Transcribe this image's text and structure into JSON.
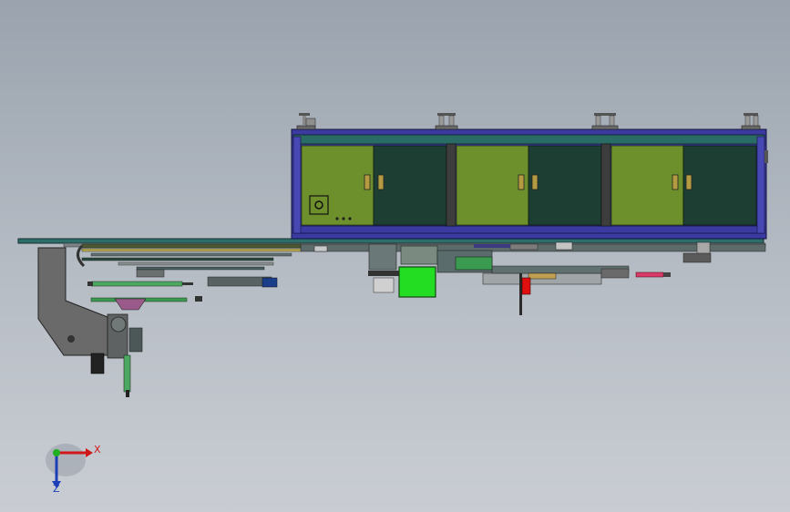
{
  "view": {
    "background_top": "#9aa3ae",
    "background_bottom": "#c9cdd3"
  },
  "cabinet": {
    "frame_color": "#3a3aa0",
    "panel_color": "#6e902c",
    "dark_panel_color": "#1d3f33",
    "top_beam_color": "#2b6b66",
    "bay_count": 3
  },
  "highlights": {
    "green_box_color": "#22dd22",
    "red_part_color": "#e01010",
    "pink_cylinder_color": "#d83a6a"
  },
  "triad": {
    "x_label": "X",
    "z_label": "Z",
    "x_color": "#d01818",
    "y_color": "#20b020",
    "z_color": "#1c3fb8"
  }
}
